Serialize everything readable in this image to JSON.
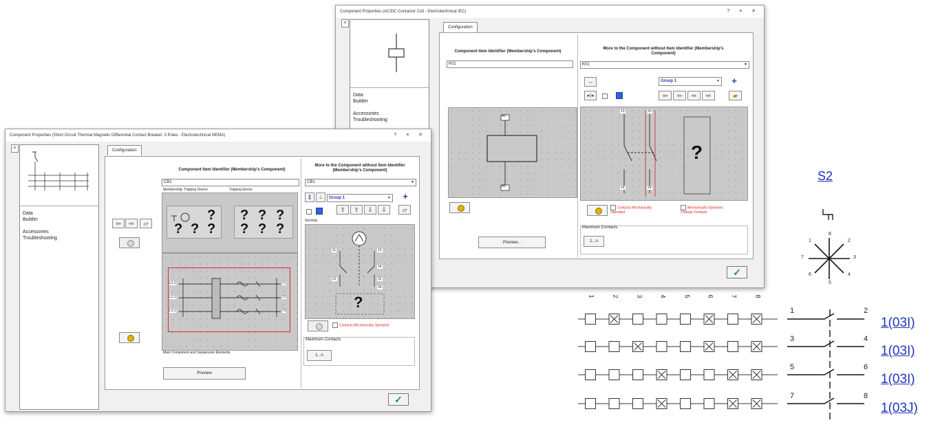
{
  "window_back": {
    "title": "Component Properties (AC/DC Contactor Coil - Electrotechnical IEC)",
    "controls": "? ≡ ✕",
    "collapse": "<",
    "sidebar_links": [
      "Data",
      "Builder",
      "",
      "Accessories",
      "Troubleshooting"
    ],
    "tab": "Configuration",
    "left_title": "Component Item Identifier (Membership's Component)",
    "left_field": "K01",
    "right_title": "More to the Component without Item Identifier (Membership's Component)",
    "right_field": "K01",
    "group": "Group 1",
    "coil_top": "A1",
    "coil_bottom": "A2",
    "contact_pins": [
      "13",
      "23",
      "14",
      "24"
    ],
    "qmark": "?",
    "chk1": "Contacts Mechanically Operated",
    "chk2": "Mechanically Operated Change Contacts",
    "preview": "Preview...",
    "max_contacts": "Maximum Contacts",
    "max_btn": "1...n",
    "ok": "✓"
  },
  "window_front": {
    "title": "Component Properties (Short Circuit Thermal Magnetic Differential Contact Breaker, 3 Poles - Electrotechnical NEMA)",
    "controls": "? ≡ ✕",
    "collapse": "<",
    "sidebar_links": [
      "Data",
      "Builder",
      "",
      "Accessories",
      "Troubleshooting"
    ],
    "tab": "Configuration",
    "center_title": "Component Item Identifier (Membership's Component)",
    "center_field": "CB1",
    "sub_labels": [
      "Membership: Tripping Device",
      "Tripping device"
    ],
    "qmark": "?",
    "pole_labels_left": [
      "L1.1",
      "L2.1",
      "L3.1"
    ],
    "pole_labels_right": [
      "T1",
      "T2",
      "T3"
    ],
    "main_caption": "Main Component and Suspension Elements",
    "right_title": "More to the Component without Item Identifier (Membership's Component)",
    "right_field": "CB1",
    "group": "Group 1",
    "sensing_label": "Sensing",
    "aux_pins": [
      "11",
      "12",
      "14",
      "21",
      "22",
      "24"
    ],
    "chk": "Contacts Mechanically Operated",
    "preview": "Preview",
    "max_contacts": "Maximum Contacts",
    "max_btn": "1...n",
    "ok": "✓"
  },
  "schematic": {
    "title": "S2",
    "dial_positions": [
      "1",
      "2",
      "3",
      "4",
      "5",
      "6",
      "7",
      "8"
    ],
    "column_numbers": [
      "1",
      "2",
      "3",
      "4",
      "5",
      "6",
      "7",
      "8"
    ],
    "rows": [
      {
        "pins": [
          "1",
          "2"
        ],
        "ref": "1(03I)",
        "boxes": [
          0,
          1,
          0,
          0,
          0,
          1,
          0,
          1
        ]
      },
      {
        "pins": [
          "3",
          "4"
        ],
        "ref": "1(03I)",
        "boxes": [
          0,
          0,
          1,
          0,
          0,
          1,
          0,
          1
        ]
      },
      {
        "pins": [
          "5",
          "6"
        ],
        "ref": "1(03I)",
        "boxes": [
          0,
          0,
          0,
          1,
          0,
          0,
          1,
          1
        ]
      },
      {
        "pins": [
          "7",
          "8"
        ],
        "ref": "1(03J)",
        "boxes": [
          0,
          0,
          0,
          1,
          0,
          0,
          1,
          1
        ]
      }
    ]
  }
}
